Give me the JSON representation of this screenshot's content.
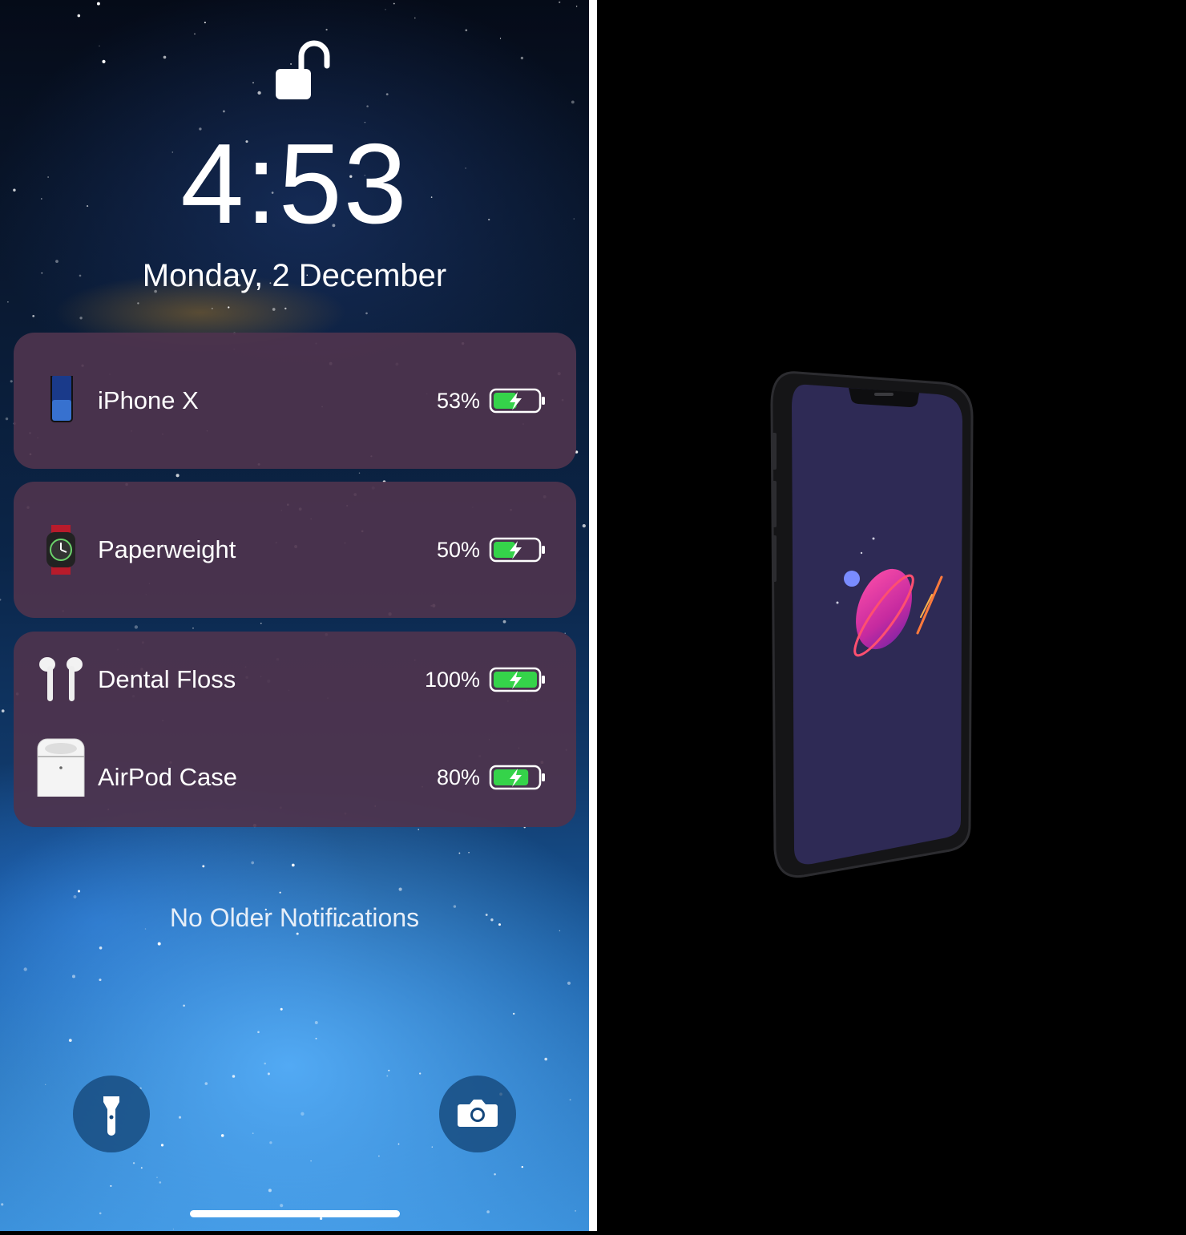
{
  "lockscreen": {
    "time": "4:53",
    "date": "Monday, 2 December",
    "footer_text": "No Older Notifications",
    "widgets": [
      {
        "devices": [
          {
            "name": "iPhone X",
            "percent": "53%",
            "level": 0.53,
            "icon": "iphone-icon"
          }
        ]
      },
      {
        "devices": [
          {
            "name": "Paperweight",
            "percent": "50%",
            "level": 0.5,
            "icon": "watch-icon"
          }
        ]
      },
      {
        "devices": [
          {
            "name": "Dental Floss",
            "percent": "100%",
            "level": 1.0,
            "icon": "airpods-icon"
          },
          {
            "name": "AirPod Case",
            "percent": "80%",
            "level": 0.8,
            "icon": "airpods-case-icon"
          }
        ]
      }
    ],
    "buttons": {
      "left": "flashlight-icon",
      "right": "camera-icon"
    },
    "colors": {
      "card": "#4e344e",
      "battery_fill": "#35d34a",
      "button": "#14467a"
    }
  },
  "render": {
    "subject": "phone-render",
    "colors": {
      "screen": "#2e2a55",
      "planet": "#d02a9c"
    }
  }
}
